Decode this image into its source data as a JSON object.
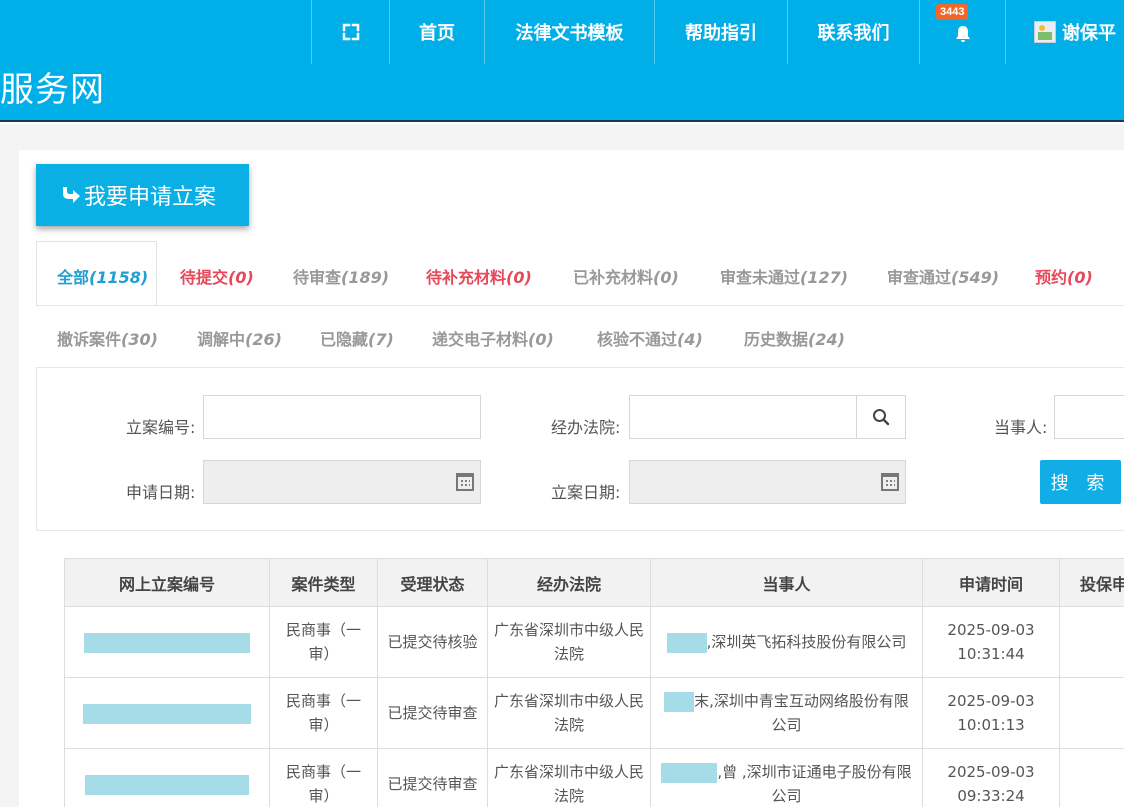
{
  "header": {
    "site_title": "服务网",
    "nav": {
      "fullscreen_icon": "expand-icon",
      "home": "首页",
      "templates": "法律文书模板",
      "help": "帮助指引",
      "contact": "联系我们",
      "notification_count": "3443",
      "user_name": "谢保平"
    }
  },
  "apply_button": {
    "label": "我要申请立案"
  },
  "tabs": [
    {
      "label": "全部",
      "count": "(1158)"
    },
    {
      "label": "待提交",
      "count": "(0)"
    },
    {
      "label": "待审查",
      "count": "(189)"
    },
    {
      "label": "待补充材料",
      "count": "(0)"
    },
    {
      "label": "已补充材料",
      "count": "(0)"
    },
    {
      "label": "审查未通过",
      "count": "(127)"
    },
    {
      "label": "审查通过",
      "count": "(549)"
    },
    {
      "label": "预约",
      "count": "(0)"
    },
    {
      "label": "撤诉案件",
      "count": "(30)"
    },
    {
      "label": "调解中",
      "count": "(26)"
    },
    {
      "label": "已隐藏",
      "count": "(7)"
    },
    {
      "label": "递交电子材料",
      "count": "(0)"
    },
    {
      "label": "核验不通过",
      "count": "(4)"
    },
    {
      "label": "历史数据",
      "count": "(24)"
    }
  ],
  "filters": {
    "case_no_label": "立案编号:",
    "court_label": "经办法院:",
    "party_label": "当事人:",
    "apply_date_label": "申请日期:",
    "filing_date_label": "立案日期:",
    "search_label": "搜 索"
  },
  "table": {
    "headers": [
      "网上立案编号",
      "案件类型",
      "受理状态",
      "经办法院",
      "当事人",
      "申请时间",
      "投保申"
    ],
    "rows": [
      {
        "type": "民商事（一审）",
        "status": "已提交待核验",
        "court": "广东省深圳市中级人民法院",
        "party": ",深圳英飞拓科技股份有限公司",
        "date": "2025-09-03",
        "time": "10:31:44"
      },
      {
        "type": "民商事（一审）",
        "status": "已提交待审查",
        "court": "广东省深圳市中级人民法院",
        "party": "末,深圳中青宝互动网络股份有限公司",
        "date": "2025-09-03",
        "time": "10:01:13"
      },
      {
        "type": "民商事（一审）",
        "status": "已提交待审查",
        "court": "广东省深圳市中级人民法院",
        "party": ",曾  ,深圳市证通电子股份有限公司",
        "date": "2025-09-03",
        "time": "09:33:24"
      }
    ]
  },
  "colors": {
    "header_bg": "#00aee8",
    "accent": "#1f9fd4",
    "alert_red": "#e8495a",
    "badge": "#f0672a",
    "redaction": "#a6dbe8"
  }
}
